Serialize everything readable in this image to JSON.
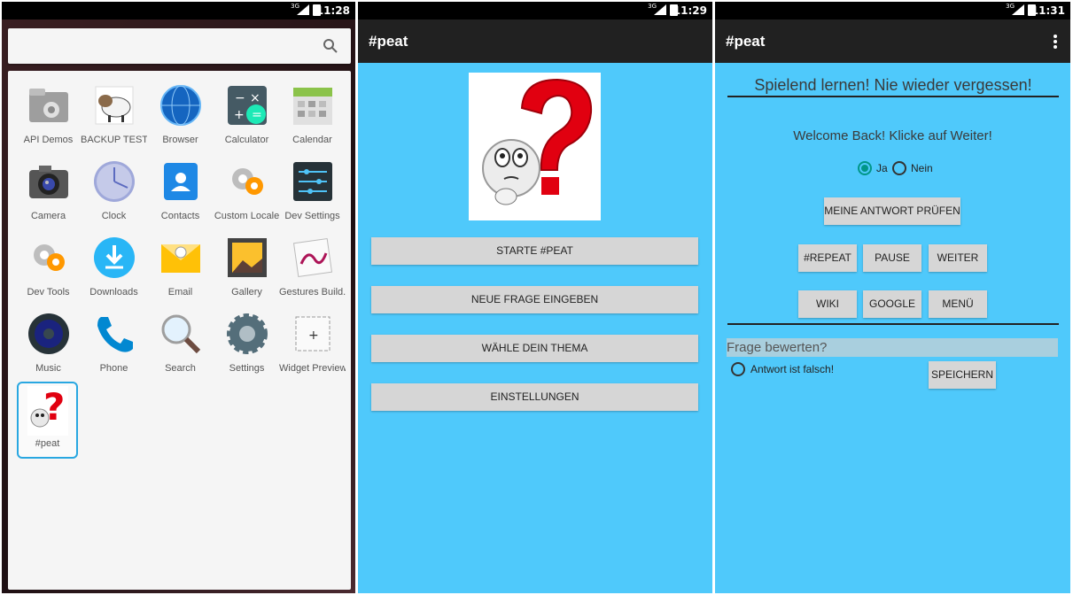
{
  "phone1": {
    "status": {
      "time": "11:28",
      "network": "3G"
    },
    "search": {
      "placeholder": ""
    },
    "apps": [
      {
        "label": "API Demos",
        "icon": "folder-gear-icon"
      },
      {
        "label": "BACKUP TEST",
        "icon": "sheep-icon"
      },
      {
        "label": "Browser",
        "icon": "globe-icon"
      },
      {
        "label": "Calculator",
        "icon": "calculator-icon"
      },
      {
        "label": "Calendar",
        "icon": "calendar-icon"
      },
      {
        "label": "Camera",
        "icon": "camera-icon"
      },
      {
        "label": "Clock",
        "icon": "clock-icon"
      },
      {
        "label": "Contacts",
        "icon": "contacts-icon"
      },
      {
        "label": "Custom Locale",
        "icon": "gear-icon"
      },
      {
        "label": "Dev Settings",
        "icon": "sliders-icon"
      },
      {
        "label": "Dev Tools",
        "icon": "gear-icon"
      },
      {
        "label": "Downloads",
        "icon": "download-icon"
      },
      {
        "label": "Email",
        "icon": "envelope-icon"
      },
      {
        "label": "Gallery",
        "icon": "picture-icon"
      },
      {
        "label": "Gestures Build..",
        "icon": "gesture-icon"
      },
      {
        "label": "Music",
        "icon": "speaker-icon"
      },
      {
        "label": "Phone",
        "icon": "phone-icon"
      },
      {
        "label": "Search",
        "icon": "magnifier-icon"
      },
      {
        "label": "Settings",
        "icon": "settings-gear-icon"
      },
      {
        "label": "Widget Preview",
        "icon": "widget-icon"
      },
      {
        "label": "#peat",
        "icon": "question-face-icon"
      }
    ]
  },
  "phone2": {
    "status": {
      "time": "11:29",
      "network": "3G"
    },
    "title": "#peat",
    "buttons": [
      "STARTE #PEAT",
      "NEUE FRAGE EINGEBEN",
      "WÄHLE DEIN THEMA",
      "EINSTELLUNGEN"
    ]
  },
  "phone3": {
    "status": {
      "time": "11:31",
      "network": "3G"
    },
    "title": "#peat",
    "headline": "Spielend lernen! Nie wieder vergessen!",
    "welcome": "Welcome Back! Klicke auf Weiter!",
    "radio_yes": "Ja",
    "radio_no": "Nein",
    "check_button": "MEINE ANTWORT PRÜFEN",
    "row1": [
      "#REPEAT",
      "PAUSE",
      "WEITER"
    ],
    "row2": [
      "WIKI",
      "GOOGLE",
      "MENÜ"
    ],
    "rate_label": "Frage bewerten?",
    "wrong_answer": "Antwort ist falsch!",
    "save_button": "SPEICHERN"
  },
  "colors": {
    "accent": "#4fc9fb",
    "appbar": "#212121",
    "radio_checked": "#009688",
    "button": "#d6d6d6"
  }
}
